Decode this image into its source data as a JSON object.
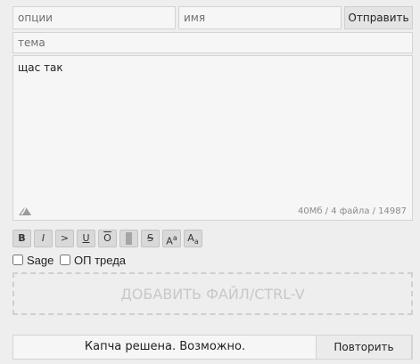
{
  "form": {
    "options_placeholder": "опции",
    "name_placeholder": "имя",
    "send_label": "Отправить",
    "subject_placeholder": "тема",
    "message_text": "щас так",
    "limits_text": "40Мб / 4 файла / 14987"
  },
  "toolbar": {
    "bold": "B",
    "italic": "I",
    "quote": ">",
    "underline": "U",
    "overline": "O",
    "spoiler": "",
    "strike": "S",
    "sup_base": "A",
    "sup_mark": "a",
    "sub_base": "A",
    "sub_mark": "a"
  },
  "checkboxes": {
    "sage_label": "Sage",
    "op_label": "ОП треда"
  },
  "dropzone_label": "ДОБАВИТЬ ФАЙЛ/CTRL-V",
  "captcha": {
    "status": "Капча решена. Возможно.",
    "retry_label": "Повторить"
  },
  "icons": {
    "oekaki": "draw-icon"
  }
}
